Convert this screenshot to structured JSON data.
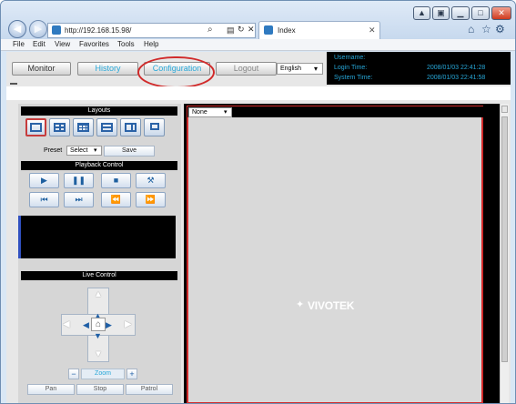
{
  "browser": {
    "url": "http://192.168.15.98/",
    "tab_title": "Index",
    "menu": [
      "File",
      "Edit",
      "View",
      "Favorites",
      "Tools",
      "Help"
    ]
  },
  "app": {
    "top_buttons": [
      "Monitor",
      "History",
      "Configuration",
      "Logout"
    ],
    "language": "English",
    "info": {
      "username_label": "Username:",
      "login_label": "Login Time:",
      "login_value": "2008/01/03 22:41:28",
      "system_label": "System Time:",
      "system_value": "2008/01/03 22:41:58"
    },
    "layouts_title": "Layouts",
    "preset_label": "Preset",
    "preset_value": "Select",
    "save_label": "Save",
    "playback_title": "Playback Control",
    "live_title": "Live Control",
    "zoom_label": "Zoom",
    "bottom_buttons": [
      "Pan",
      "Stop",
      "Patrol"
    ],
    "camera_select": "None",
    "logo_text": "VIVOTEK"
  },
  "colors": {
    "accent": "#27a7d8",
    "highlight": "#d12a2a"
  }
}
